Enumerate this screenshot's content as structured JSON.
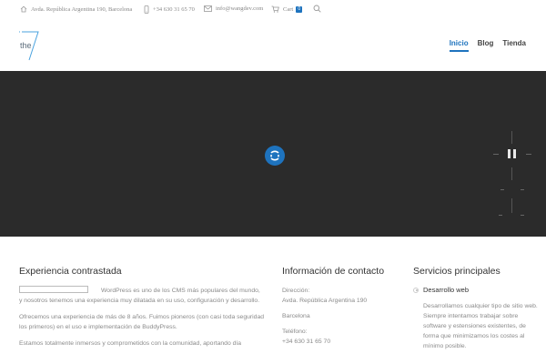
{
  "topbar": {
    "address": "Avda. República Argentina 190, Barcelona",
    "phone": "+34 630 31 65 70",
    "email": "info@wangdev.com",
    "cart_label": "Cart",
    "cart_count": "0"
  },
  "logo": {
    "text": "the",
    "numeral": "7"
  },
  "nav": [
    {
      "label": "Inicio",
      "active": true
    },
    {
      "label": "Blog",
      "active": false
    },
    {
      "label": "Tienda",
      "active": false
    }
  ],
  "slider": {
    "state": "loading"
  },
  "experience": {
    "title": "Experiencia contrastada",
    "p1": "WordPress es uno de los CMS más populares del mundo, y nosotros tenemos una experiencia muy dilatada en su uso, configuración y desarrollo.",
    "p2": "Ofrecemos una experiencia de más de 8 años. Fuimos pioneros (con casi toda seguridad los primeros) en el uso e implementación de BuddyPress.",
    "p3": "Estamos totalmente inmersos y comprometidos con la comunidad, aportando día"
  },
  "contact": {
    "title": "Información de contacto",
    "address_label": "Dirección:",
    "address_line1": "Avda. República Argentina 190",
    "address_line2": "Barcelona",
    "phone_label": "Teléfono:",
    "phone": "+34 630 31 65 70"
  },
  "services": {
    "title": "Servicios principales",
    "item_title": "Desarrollo web",
    "item_text": "Desarrollamos cualquier tipo de sitio web. Siempre intentamos trabajar sobre software y estensiones existentes, de forma que minimizamos los costes al mínimo posible."
  },
  "colors": {
    "accent": "#1e73be",
    "slider_bg": "#2b2b2b"
  }
}
